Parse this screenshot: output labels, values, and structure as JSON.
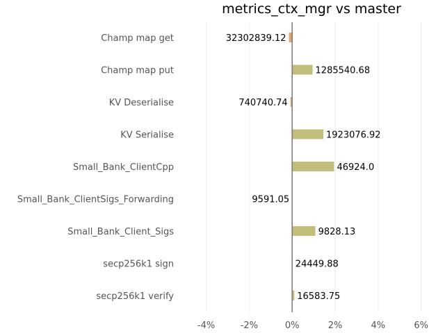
{
  "chart_data": {
    "type": "bar",
    "orientation": "horizontal",
    "title": "metrics_ctx_mgr vs master",
    "xlabel": "",
    "ylabel": "",
    "x_unit": "%",
    "xlim": [
      -4.6,
      6.4
    ],
    "xticks": [
      -4,
      -2,
      0,
      2,
      4,
      6
    ],
    "xtick_labels": [
      "-4%",
      "-2%",
      "0%",
      "2%",
      "4%",
      "6%"
    ],
    "grid": "vertical",
    "legend": "none",
    "categories": [
      "Champ map get",
      "Champ map put",
      "KV Deserialise",
      "KV Serialise",
      "Small_Bank_ClientCpp",
      "Small_Bank_ClientSigs_Forwarding",
      "Small_Bank_Client_Sigs",
      "secp256k1 sign",
      "secp256k1 verify"
    ],
    "values": [
      -0.15,
      0.95,
      -0.08,
      1.45,
      1.95,
      0.0,
      1.08,
      0.02,
      0.1
    ],
    "labels": [
      "32302839.12",
      "1285540.68",
      "740740.74",
      "1923076.92",
      "46924.0",
      "9591.05",
      "9828.13",
      "24449.88",
      "16583.75"
    ],
    "colors": {
      "positive": "#c2bd7a",
      "negative": "#e0a571",
      "zero_line": "#777777",
      "grid": "#eeeeee"
    }
  }
}
